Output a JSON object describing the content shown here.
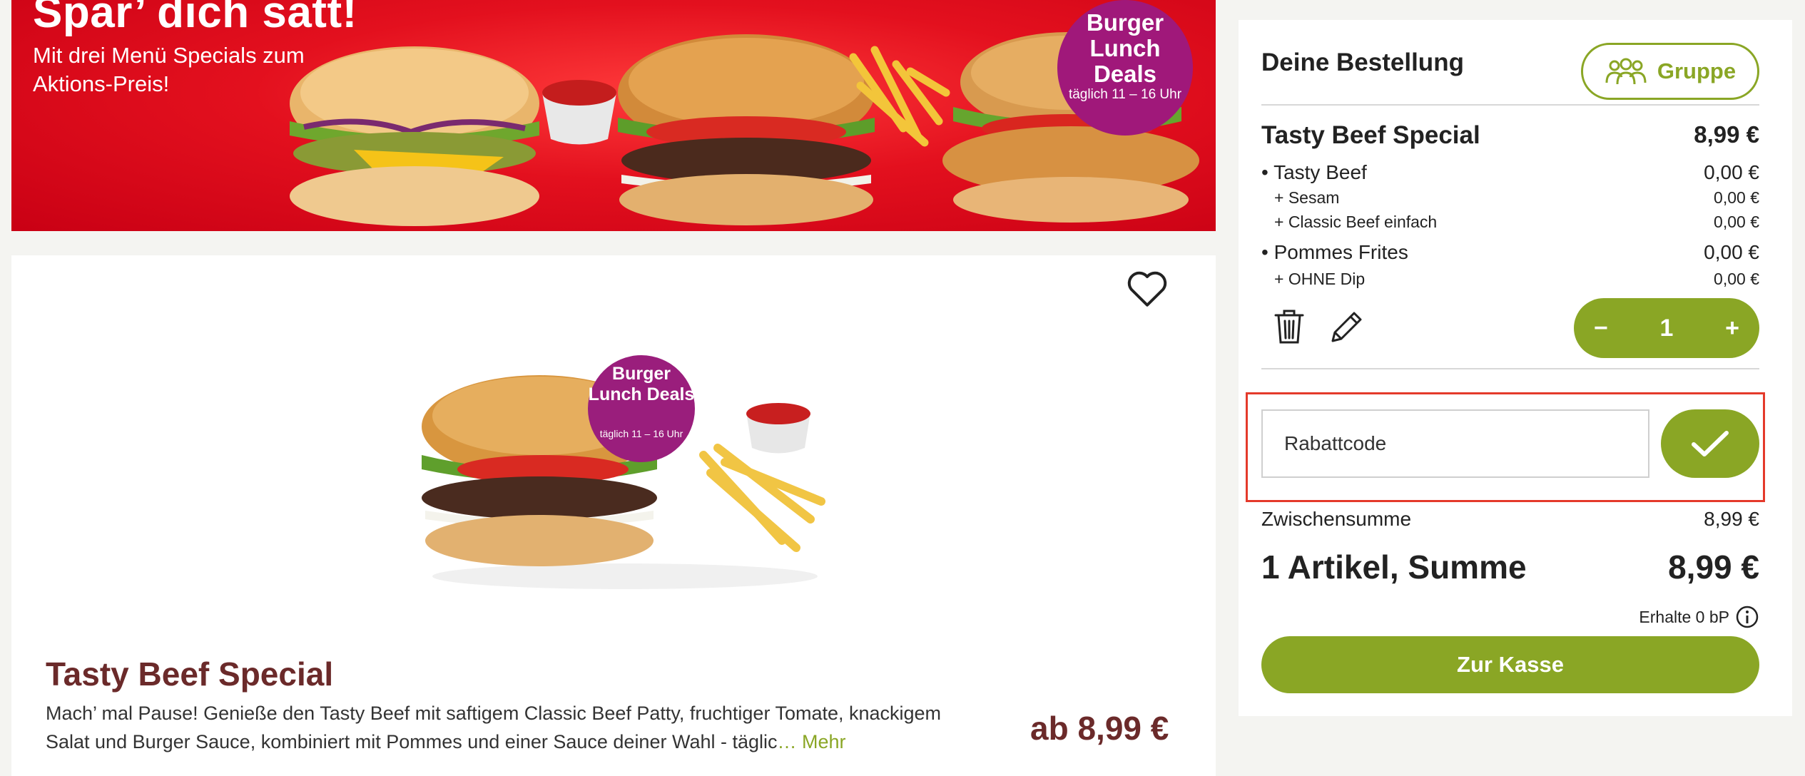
{
  "banner": {
    "title": "Spar’ dich satt!",
    "subtitle": "Mit drei Menü Specials zum Aktions-Preis!",
    "badge": {
      "line1": "Burger Lunch Deals",
      "line2": "täglich 11 – 16 Uhr"
    }
  },
  "product": {
    "title": "Tasty Beef Special",
    "description": "Mach’ mal Pause! Genieße den Tasty Beef mit saftigem Classic Beef Patty, fruchtiger Tomate, knackigem Salat und Burger Sauce, kombiniert mit Pommes und einer Sauce deiner Wahl - täglic",
    "more_label": "… Mehr",
    "price": "ab 8,99  €",
    "badge": {
      "line1": "Burger Lunch Deals",
      "line2": "täglich 11 – 16 Uhr"
    }
  },
  "order": {
    "heading": "Deine Bestellung",
    "group_label": "Gruppe",
    "item": {
      "title": "Tasty Beef Special",
      "price": "8,99 €",
      "lines": [
        {
          "label": "• Tasty Beef",
          "price": "0,00 €"
        },
        {
          "label": "+ Sesam",
          "price": "0,00 €"
        },
        {
          "label": "+ Classic Beef einfach",
          "price": "0,00 €"
        },
        {
          "label": "• Pommes Frites",
          "price": "0,00 €"
        },
        {
          "label": "+ OHNE Dip",
          "price": "0,00 €"
        }
      ],
      "quantity": "1",
      "minus": "−",
      "plus": "+"
    },
    "coupon_placeholder": "Rabattcode",
    "subtotal_label": "Zwischensumme",
    "subtotal_value": "8,99 €",
    "total_label": "1 Artikel, Summe",
    "total_value": "8,99 €",
    "points_label": "Erhalte 0 bP",
    "checkout_label": "Zur Kasse"
  },
  "colors": {
    "accent": "#8aa625",
    "product_title": "#6b2a2a",
    "banner_red": "#e3101e",
    "badge_purple": "#a0187a",
    "highlight_frame": "#e43a2b"
  },
  "icons": [
    "heart-icon",
    "group-icon",
    "trash-icon",
    "pencil-icon",
    "check-icon",
    "info-icon"
  ]
}
